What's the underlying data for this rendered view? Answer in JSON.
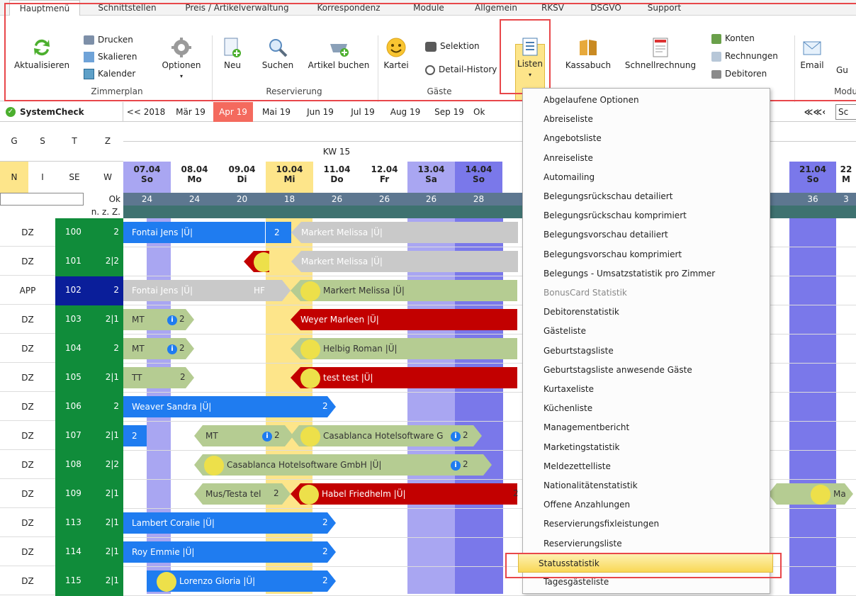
{
  "tabs": [
    "Hauptmenü",
    "Schnittstellen",
    "Preis / Artikelverwaltung",
    "Korrespondenz",
    "Module",
    "Allgemein",
    "RKSV",
    "DSGVO",
    "Support"
  ],
  "ribbon": {
    "aktualisieren": "Aktualisieren",
    "drucken": "Drucken",
    "skalieren": "Skalieren",
    "kalender": "Kalender",
    "optionen": "Optionen",
    "neu": "Neu",
    "suchen": "Suchen",
    "artikel_buchen": "Artikel buchen",
    "kartei": "Kartei",
    "selektion": "Selektion",
    "detail_history": "Detail-History",
    "listen": "Listen",
    "kassabuch": "Kassabuch",
    "schnellrechnung": "Schnellrechnung",
    "konten": "Konten",
    "rechnungen": "Rechnungen",
    "debitoren": "Debitoren",
    "email": "Email",
    "gu": "Gu",
    "groups": {
      "zimmerplan": "Zimmerplan",
      "reservierung": "Reservierung",
      "gaeste": "Gäste",
      "modu": "Modu"
    }
  },
  "calendar": {
    "systemcheck": "SystemCheck",
    "months": [
      "<< 2018",
      "Mär 19",
      "Apr 19",
      "Mai 19",
      "Jun 19",
      "Jul 19",
      "Aug 19",
      "Sep 19",
      "Ok"
    ],
    "nav_search": "Sc",
    "filter_headers": [
      "G",
      "S",
      "T",
      "Z"
    ],
    "filter_values": [
      "N",
      "I",
      "SE",
      "W"
    ],
    "ok": "Ok",
    "nzz": "n. z. Z.",
    "week": "KW 15",
    "days": [
      {
        "date": "07.04",
        "day": "So",
        "count": "24"
      },
      {
        "date": "08.04",
        "day": "Mo",
        "count": "24"
      },
      {
        "date": "09.04",
        "day": "Di",
        "count": "20"
      },
      {
        "date": "10.04",
        "day": "Mi",
        "count": "18"
      },
      {
        "date": "11.04",
        "day": "Do",
        "count": "26"
      },
      {
        "date": "12.04",
        "day": "Fr",
        "count": "26"
      },
      {
        "date": "13.04",
        "day": "Sa",
        "count": "26"
      },
      {
        "date": "14.04",
        "day": "So",
        "count": "28"
      }
    ],
    "day_right": {
      "date": "21.04",
      "day": "So",
      "count": "36"
    },
    "day_right2": {
      "date": "22",
      "day": "M",
      "count": "3"
    },
    "rooms": [
      {
        "type": "DZ",
        "no": "100",
        "cap": "2"
      },
      {
        "type": "DZ",
        "no": "101",
        "cap": "2|2"
      },
      {
        "type": "APP",
        "no": "102",
        "cap": "2"
      },
      {
        "type": "DZ",
        "no": "103",
        "cap": "2|1"
      },
      {
        "type": "DZ",
        "no": "104",
        "cap": "2"
      },
      {
        "type": "DZ",
        "no": "105",
        "cap": "2|1"
      },
      {
        "type": "DZ",
        "no": "106",
        "cap": "2"
      },
      {
        "type": "DZ",
        "no": "107",
        "cap": "2|1"
      },
      {
        "type": "DZ",
        "no": "108",
        "cap": "2|2"
      },
      {
        "type": "DZ",
        "no": "109",
        "cap": "2|1"
      },
      {
        "type": "DZ",
        "no": "113",
        "cap": "2|1"
      },
      {
        "type": "DZ",
        "no": "114",
        "cap": "2|1"
      },
      {
        "type": "DZ",
        "no": "115",
        "cap": "2|1"
      }
    ],
    "bookings": {
      "r100a": "Fontai Jens |Ü|",
      "r100b": "2",
      "r100c": "Markert Melissa |Ü|",
      "r101a": "2",
      "r101b": "Markert Melissa |Ü|",
      "r102a": "Fontai Jens |Ü|",
      "r102b": "HF",
      "r102c": "Markert Melissa |Ü|",
      "r103a": "MT",
      "r103b": "2",
      "r103c": "Weyer Marleen |Ü|",
      "r104a": "MT",
      "r104b": "2",
      "r104c": "Helbig Roman |Ü|",
      "r105a": "TT",
      "r105b": "2",
      "r105c": "test test |Ü|",
      "r106a": "Weaver Sandra |Ü|",
      "r106b": "2",
      "r107a": "2",
      "r107b": "MT",
      "r107c": "2",
      "r107d": "Casablanca Hotelsoftware G",
      "r107e": "2",
      "r108a": "Casablanca Hotelsoftware GmbH |Ü|",
      "r108b": "2",
      "r109a": "Mus/Testa tel",
      "r109b": "2",
      "r109c": "Habel Friedhelm |Ü|",
      "r109d": "2",
      "r109e": "Ma",
      "r113a": "Lambert Coralie |Ü|",
      "r113b": "2",
      "r114a": "Roy Emmie |Ü|",
      "r114b": "2",
      "r115a": "Lorenzo Gloria |Ü|",
      "r115b": "2"
    }
  },
  "dropdown": [
    "Abgelaufene Optionen",
    "Abreiseliste",
    "Angebotsliste",
    "Anreiseliste",
    "Automailing",
    "Belegungsrückschau detailiert",
    "Belegungsrückschau komprimiert",
    "Belegungsvorschau detailiert",
    "Belegungsvorschau komprimiert",
    "Belegungs - Umsatzstatistik pro Zimmer",
    "BonusCard Statistik",
    "Debitorenstatistik",
    "Gästeliste",
    "Geburtstagsliste",
    "Geburtstagsliste anwesende Gäste",
    "Kurtaxeliste",
    "Küchenliste",
    "Managementbericht",
    "Marketingstatistik",
    "Meldezettelliste",
    "Nationalitätenstatistik",
    "Offene Anzahlungen",
    "Reservierungsfixleistungen",
    "Reservierungsliste",
    "Statusstatistik",
    "Tagesgästeliste"
  ],
  "colors": {
    "accent_red": "#e8474a",
    "highlight": "#f9d856",
    "booking_blue": "#1f7cf0",
    "booking_green": "#b5cc92",
    "booking_red": "#c20000",
    "weekend": "#a9a6f2"
  }
}
